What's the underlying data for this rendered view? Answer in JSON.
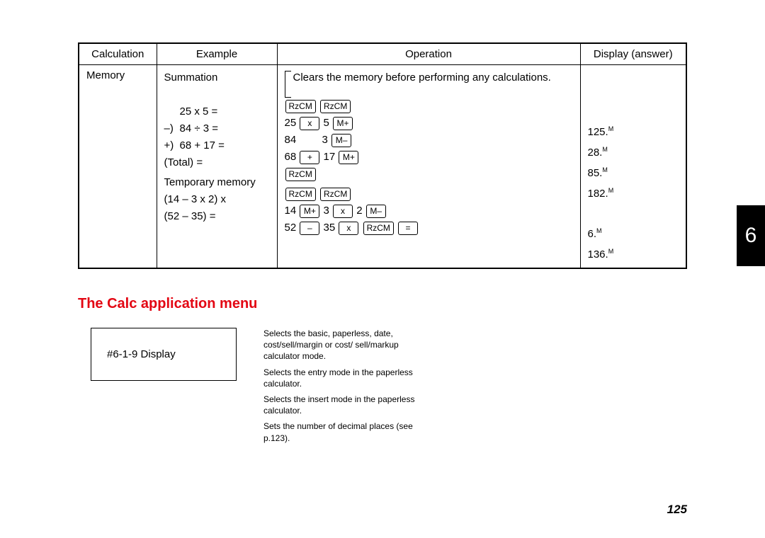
{
  "table": {
    "headers": {
      "calc": "Calculation",
      "example": "Example",
      "op": "Operation",
      "ans": "Display (answer)"
    },
    "calc_label": "Memory",
    "summation_label": "Summation",
    "clear_note": "Clears the memory before performing any calculations.",
    "ex": {
      "l1": "25 x 5 =",
      "l2_pre": "–)",
      "l2": "84 ÷ 3 =",
      "l3_pre": "+)",
      "l3": "68 + 17 =",
      "l4": "(Total) =",
      "tmp": "Temporary memory",
      "l5": "(14 – 3 x 2) x",
      "l6": "(52 – 35) ="
    },
    "keys": {
      "rzcm": "RᴢCM",
      "x": "x",
      "mplus": "M+",
      "mminus": "M–",
      "plus": "+",
      "minus": "–",
      "eq": "="
    },
    "op": {
      "n25": "25",
      "n5": "5",
      "n84": "84",
      "n3": "3",
      "n68": "68",
      "n17": "17",
      "n14": "14",
      "n2": "2",
      "n52": "52",
      "n35": "35"
    },
    "ans": {
      "a1": "125.",
      "a2": "28.",
      "a3": "85.",
      "a4": "182.",
      "a5": "6.",
      "a6": "136.",
      "m": "M"
    }
  },
  "section_title": "The Calc application menu",
  "display_box": "#6-1-9 Display",
  "menu": {
    "d1": "Selects the basic, paperless, date, cost/sell/margin or cost/ sell/markup calculator mode.",
    "d2": "Selects the entry mode in the paperless calculator.",
    "d3": "Selects the insert mode in the paperless calculator.",
    "d4": "Sets the number of decimal places (see p.123)."
  },
  "tab": "6",
  "page_number": "125"
}
